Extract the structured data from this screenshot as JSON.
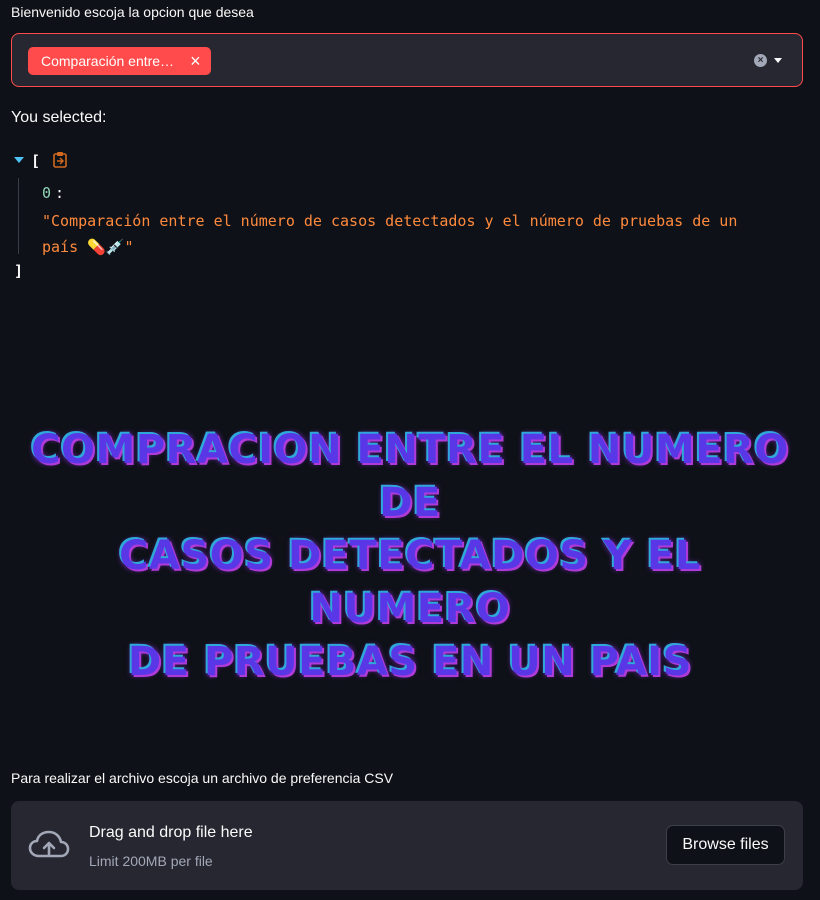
{
  "select": {
    "label": "Bienvenido escoja la opcion que desea",
    "chip_label": "Comparación entre…",
    "accent": "#ff4b4b"
  },
  "selection": {
    "heading": "You selected:",
    "json_open": "[",
    "json_close": "]",
    "index": "0",
    "colon": ":",
    "value": "\"Comparación entre el número de casos detectados y el número de pruebas de un país 💊💉\""
  },
  "title": {
    "line1": "COMPRACION ENTRE EL NUMERO DE",
    "line2": "CASOS DETECTADOS Y EL NUMERO",
    "line3": "DE PRUEBAS EN UN PAIS"
  },
  "uploader": {
    "label": "Para realizar el archivo escoja un archivo de preferencia CSV",
    "drop_title": "Drag and drop file here",
    "limit": "Limit 200MB per file",
    "browse_label": "Browse files"
  },
  "icons": {
    "chip_remove": "×",
    "clear": "×"
  }
}
